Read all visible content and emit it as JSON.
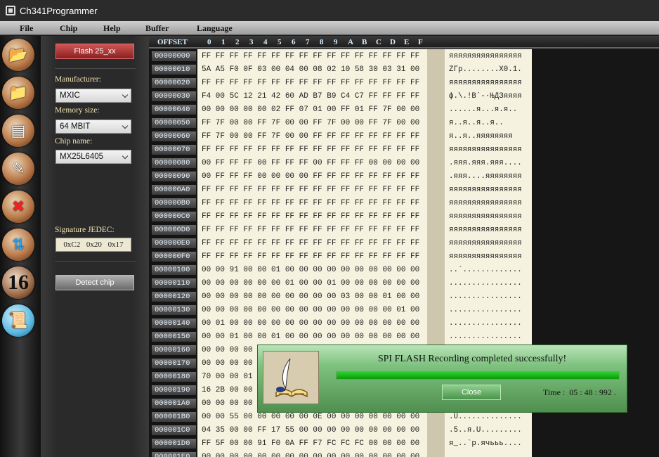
{
  "window": {
    "title": "Ch341Programmer"
  },
  "menu": [
    "File",
    "Chip",
    "Help",
    "Buffer",
    "Language"
  ],
  "toolbar": {
    "tools": [
      {
        "icon": "open-file-icon"
      },
      {
        "icon": "save-file-icon"
      },
      {
        "icon": "read-chip-icon"
      },
      {
        "icon": "write-chip-icon"
      },
      {
        "icon": "erase-chip-icon"
      },
      {
        "icon": "verify-chip-icon"
      },
      {
        "icon": "number-16-icon",
        "text": "16"
      },
      {
        "icon": "scroll-icon"
      }
    ]
  },
  "panel": {
    "flash_button": "Flash 25_xx",
    "manufacturer_label": "Manufacturer:",
    "manufacturer_value": "MXIC",
    "memory_label": "Memory size:",
    "memory_value": "64 MBIT",
    "chip_label": "Chip name:",
    "chip_value": "MX25L6405",
    "signature_label": "Signature JEDEC:",
    "signature_bytes": [
      "0xC2",
      "0x20",
      "0x17"
    ],
    "detect_button": "Detect chip"
  },
  "hex": {
    "offset_header": "OFFSET",
    "columns": [
      "0",
      "1",
      "2",
      "3",
      "4",
      "5",
      "6",
      "7",
      "8",
      "9",
      "A",
      "B",
      "C",
      "D",
      "E",
      "F"
    ],
    "offsets": [
      "00000000",
      "00000010",
      "00000020",
      "00000030",
      "00000040",
      "00000050",
      "00000060",
      "00000070",
      "00000080",
      "00000090",
      "000000A0",
      "000000B0",
      "000000C0",
      "000000D0",
      "000000E0",
      "000000F0",
      "00000100",
      "00000110",
      "00000120",
      "00000130",
      "00000140",
      "00000150",
      "00000160",
      "00000170",
      "00000180",
      "00000190",
      "000001A0",
      "000001B0",
      "000001C0",
      "000001D0",
      "000001E0"
    ],
    "rows": [
      "FF FF FF FF FF FF FF FF FF FF FF FF FF FF FF FF",
      "5A A5 F0 0F 03 00 04 00 08 02 10 58 30 03 31 00",
      "FF FF FF FF FF FF FF FF FF FF FF FF FF FF FF FF",
      "F4 00 5C 12 21 42 60 AD B7 B9 C4 C7 FF FF FF FF",
      "00 00 00 00 00 02 FF 07 01 00 FF 01 FF 7F 00 00",
      "FF 7F 00 00 FF 7F 00 00 FF 7F 00 00 FF 7F 00 00",
      "FF 7F 00 00 FF 7F 00 00 FF FF FF FF FF FF FF FF",
      "FF FF FF FF FF FF FF FF FF FF FF FF FF FF FF FF",
      "00 FF FF FF 00 FF FF FF 00 FF FF FF 00 00 00 00",
      "00 FF FF FF 00 00 00 00 FF FF FF FF FF FF FF FF",
      "FF FF FF FF FF FF FF FF FF FF FF FF FF FF FF FF",
      "FF FF FF FF FF FF FF FF FF FF FF FF FF FF FF FF",
      "FF FF FF FF FF FF FF FF FF FF FF FF FF FF FF FF",
      "FF FF FF FF FF FF FF FF FF FF FF FF FF FF FF FF",
      "FF FF FF FF FF FF FF FF FF FF FF FF FF FF FF FF",
      "FF FF FF FF FF FF FF FF FF FF FF FF FF FF FF FF",
      "00 00 91 00 00 01 00 00 00 00 00 00 00 00 00 00",
      "00 00 00 00 00 00 01 00 00 01 00 00 00 00 00 00",
      "00 00 00 00 00 00 00 00 00 00 03 00 00 01 00 00",
      "00 00 00 00 00 00 00 00 00 00 00 00 00 00 01 00",
      "00 01 00 00 00 00 00 00 00 00 00 00 00 00 00 00",
      "00 00 01 00 00 01 00 00 00 00 00 00 00 00 00 00",
      "00 00 00 00",
      "00 00 00 00",
      "70 00 00 01",
      "16 2B 00 00",
      "00 00 00 00",
      "00 00 55 00 00 00 00 00 0E 00 00 00 00 00 00 00",
      "04 35 00 00 FF 17 55 00 00 00 00 00 00 00 00 00",
      "FF 5F 00 00 91 F0 0A FF F7 FC FC FC 00 00 00 00",
      "00 00 00 00 00 00 00 00 00 00 00 00 00 00 00 00"
    ],
    "ascii": [
      "яяяяяяяяяяяяяяяя",
      "ZГр........X0.1.",
      "яяяяяяяяяяяяяяяя",
      "ф.\\.!B`-·ЊДЗяяяя",
      "......я...я.я..",
      "я..я..я..я..",
      "я..я..яяяяяяяя",
      "яяяяяяяяяяяяяяяя",
      ".яяя.яяя.яяя....",
      ".яяя....яяяяяяяя",
      "яяяяяяяяяяяяяяяя",
      "яяяяяяяяяяяяяяяя",
      "яяяяяяяяяяяяяяяя",
      "яяяяяяяяяяяяяяяя",
      "яяяяяяяяяяяяяяяя",
      "яяяяяяяяяяяяяяяя",
      "..`.............",
      "................",
      "................",
      "................",
      "................",
      "................",
      "",
      "",
      "",
      "",
      "",
      ".U..............",
      ".5..я.U.........",
      "я_..`р.ячььь....",
      "................"
    ]
  },
  "dialog": {
    "message": "SPI FLASH Recording completed successfully!",
    "progress_percent": 100,
    "close_button": "Close",
    "time_label": "Time :",
    "time_value": "05 : 48 : 992 ."
  },
  "colors": {
    "flash_button": "#b23a3a",
    "dialog_green": "#6fb06f",
    "progress_green": "#19b419",
    "hex_background": "#f5f3df",
    "label_gold": "#f2e3b0"
  }
}
